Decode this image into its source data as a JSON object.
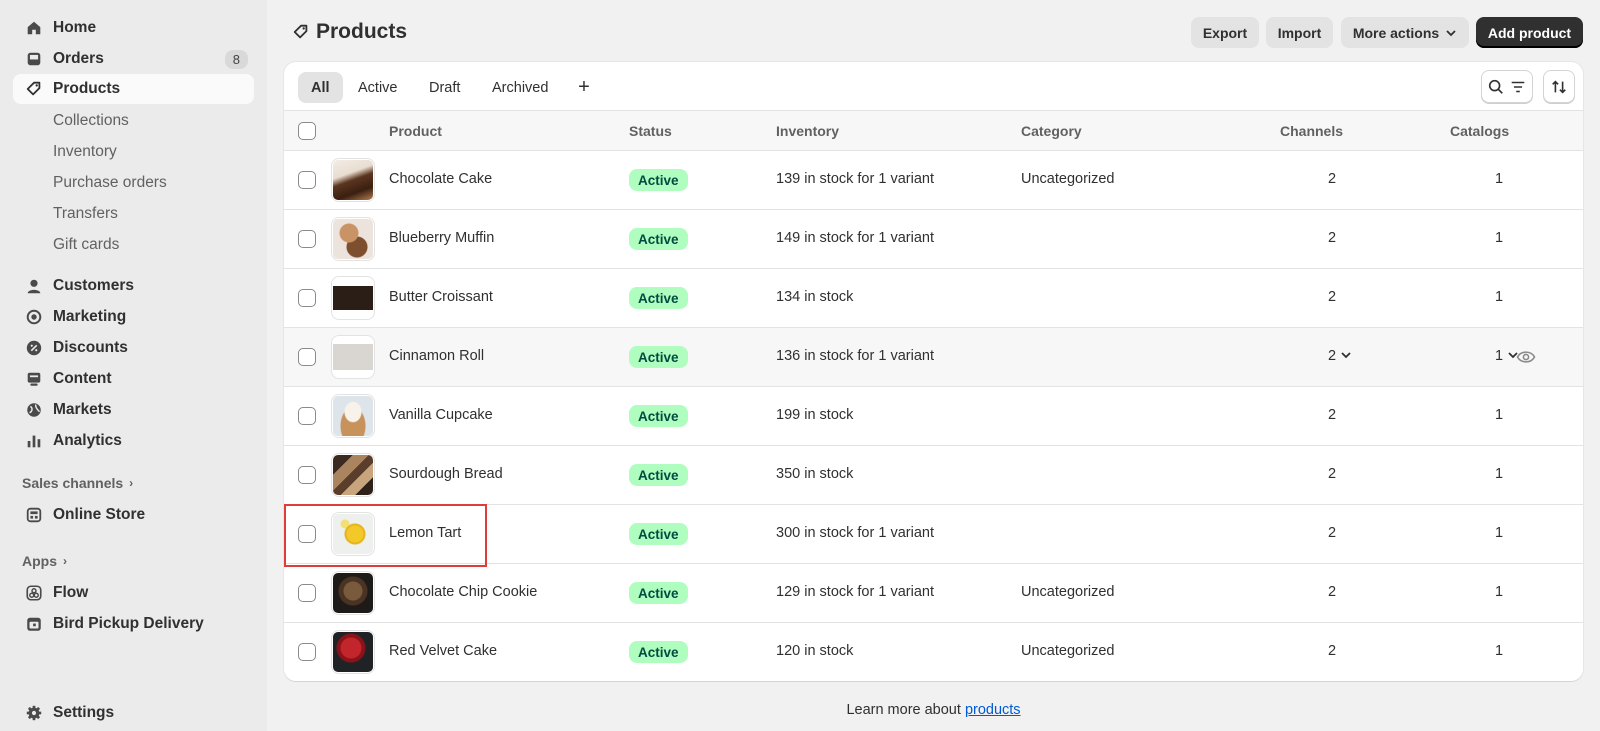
{
  "sidebar": {
    "nav": [
      {
        "label": "Home",
        "icon": "home-icon"
      },
      {
        "label": "Orders",
        "icon": "inbox-icon",
        "badge": "8"
      },
      {
        "label": "Products",
        "icon": "tag-icon"
      }
    ],
    "sub_items": [
      "Collections",
      "Inventory",
      "Purchase orders",
      "Transfers",
      "Gift cards"
    ],
    "nav2": [
      {
        "label": "Customers",
        "icon": "person-icon"
      },
      {
        "label": "Marketing",
        "icon": "target-icon"
      },
      {
        "label": "Discounts",
        "icon": "discount-icon"
      },
      {
        "label": "Content",
        "icon": "content-icon"
      },
      {
        "label": "Markets",
        "icon": "globe-icon"
      },
      {
        "label": "Analytics",
        "icon": "chart-bar-icon"
      }
    ],
    "sales_channels_label": "Sales channels",
    "online_store": "Online Store",
    "apps_label": "Apps",
    "apps": [
      "Flow",
      "Bird Pickup Delivery"
    ],
    "settings": "Settings"
  },
  "header": {
    "title": "Products",
    "export": "Export",
    "import": "Import",
    "more_actions": "More actions",
    "add_product": "Add product"
  },
  "tabs": [
    "All",
    "Active",
    "Draft",
    "Archived"
  ],
  "table": {
    "columns": [
      "Product",
      "Status",
      "Inventory",
      "Category",
      "Channels",
      "Catalogs"
    ],
    "rows": [
      {
        "name": "Chocolate Cake",
        "status": "Active",
        "inventory": "139 in stock for 1 variant",
        "category": "Uncategorized",
        "channels": "2",
        "catalogs": "1"
      },
      {
        "name": "Blueberry Muffin",
        "status": "Active",
        "inventory": "149 in stock for 1 variant",
        "category": "",
        "channels": "2",
        "catalogs": "1"
      },
      {
        "name": "Butter Croissant",
        "status": "Active",
        "inventory": "134 in stock",
        "category": "",
        "channels": "2",
        "catalogs": "1"
      },
      {
        "name": "Cinnamon Roll",
        "status": "Active",
        "inventory": "136 in stock for 1 variant",
        "category": "",
        "channels": "2",
        "catalogs": "1"
      },
      {
        "name": "Vanilla Cupcake",
        "status": "Active",
        "inventory": "199 in stock",
        "category": "",
        "channels": "2",
        "catalogs": "1"
      },
      {
        "name": "Sourdough Bread",
        "status": "Active",
        "inventory": "350 in stock",
        "category": "",
        "channels": "2",
        "catalogs": "1"
      },
      {
        "name": "Lemon Tart",
        "status": "Active",
        "inventory": "300 in stock for 1 variant",
        "category": "",
        "channels": "2",
        "catalogs": "1"
      },
      {
        "name": "Chocolate Chip Cookie",
        "status": "Active",
        "inventory": "129 in stock for 1 variant",
        "category": "Uncategorized",
        "channels": "2",
        "catalogs": "1"
      },
      {
        "name": "Red Velvet Cake",
        "status": "Active",
        "inventory": "120 in stock",
        "category": "Uncategorized",
        "channels": "2",
        "catalogs": "1"
      }
    ]
  },
  "footer": {
    "text": "Learn more about ",
    "link": "products"
  },
  "colors": {
    "status_badge_bg": "#affebf",
    "primary_button": "#303030",
    "link": "#005bd3",
    "highlight": "#e03c3c"
  }
}
